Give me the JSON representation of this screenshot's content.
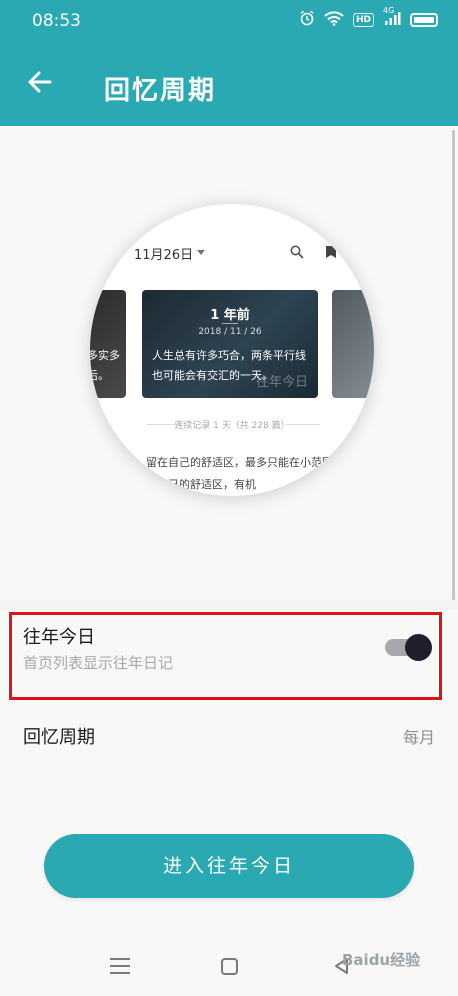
{
  "status_bar": {
    "time": "08:53",
    "hd_label": "HD",
    "network_label": "4G"
  },
  "app_bar": {
    "title": "回忆周期"
  },
  "preview": {
    "date_label": "11月26日",
    "main_card": {
      "years_ago": "1 年前",
      "date": "2018 / 11 / 26",
      "text": "人生总有许多巧合，两条平行线也可能会有交汇的一天。",
      "watermark": "往年今日"
    },
    "left_card": {
      "text": "多实多\n后。"
    },
    "streak": "连续记录 1 天（共 228 篇）",
    "paragraph": "留在自己的舒适区，最多只能在小范围而拓展自己的舒适区，有机"
  },
  "settings": {
    "today": {
      "title": "往年今日",
      "subtitle": "首页列表显示往年日记",
      "enabled": true
    },
    "period": {
      "title": "回忆周期",
      "value": "每月"
    }
  },
  "enter_button": {
    "label": "进入往年今日"
  },
  "watermark": {
    "text": "Baidu经验"
  },
  "colors": {
    "accent": "#2aa9b3",
    "highlight": "#d9141a",
    "toggle_knob": "#1f1e2c"
  }
}
